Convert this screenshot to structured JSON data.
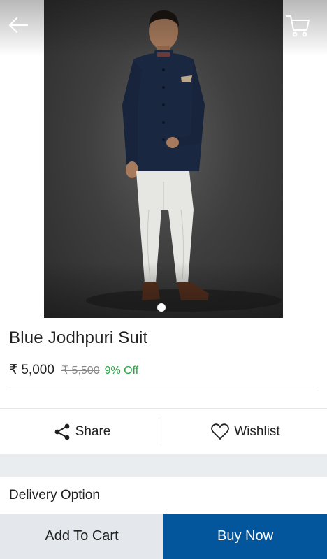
{
  "product": {
    "title": "Blue Jodhpuri Suit",
    "price": "₹ 5,000",
    "mrp": "₹ 5,500",
    "discount": "9% Off"
  },
  "actions": {
    "share_label": "Share",
    "wishlist_label": "Wishlist"
  },
  "delivery": {
    "heading": "Delivery Option"
  },
  "bottom_bar": {
    "add_to_cart_label": "Add To Cart",
    "buy_now_label": "Buy Now"
  },
  "icons": {
    "back": "arrow-left-icon",
    "cart": "cart-icon",
    "share": "share-icon",
    "wishlist": "heart-icon"
  },
  "colors": {
    "discount": "#26a541",
    "buy_now_bg": "#03569b",
    "add_to_cart_bg": "#e4e7eb"
  },
  "carousel": {
    "active_index": 1,
    "total": 1
  }
}
